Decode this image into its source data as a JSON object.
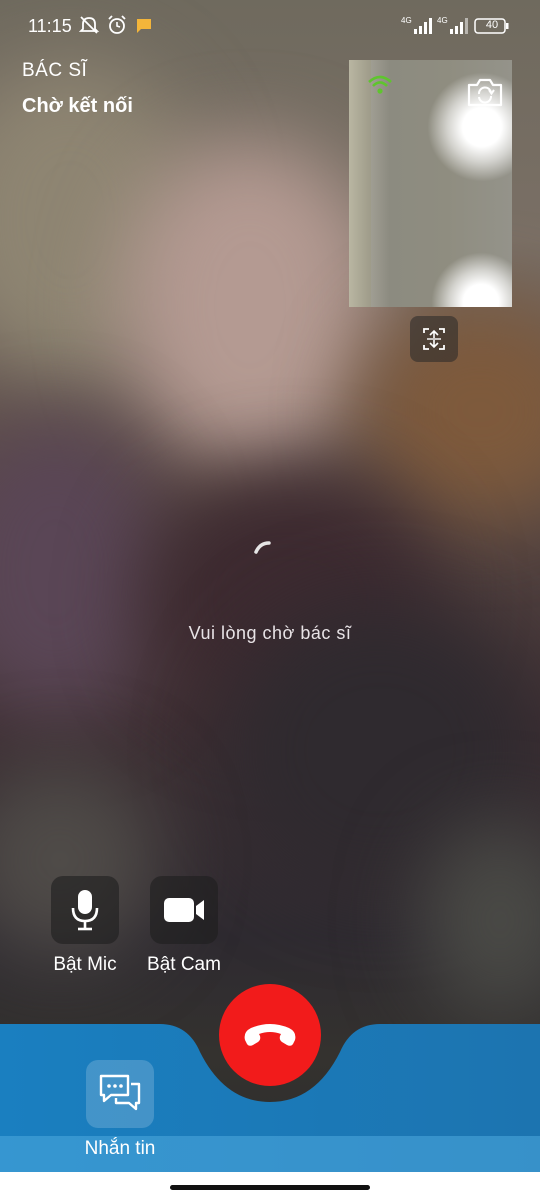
{
  "status_bar": {
    "time": "11:15",
    "network_1": "4G",
    "network_2": "4G",
    "battery": "40"
  },
  "header": {
    "role": "BÁC SĨ",
    "status": "Chờ kết nối"
  },
  "main": {
    "wait_message": "Vui lòng chờ bác sĩ"
  },
  "controls": {
    "mic_label": "Bật Mic",
    "cam_label": "Bật Cam",
    "chat_label": "Nhắn tin"
  },
  "colors": {
    "hangup": "#f21b1b",
    "bottom_bar": "#1a80bd",
    "wifi_indicator": "#5fc52e"
  }
}
